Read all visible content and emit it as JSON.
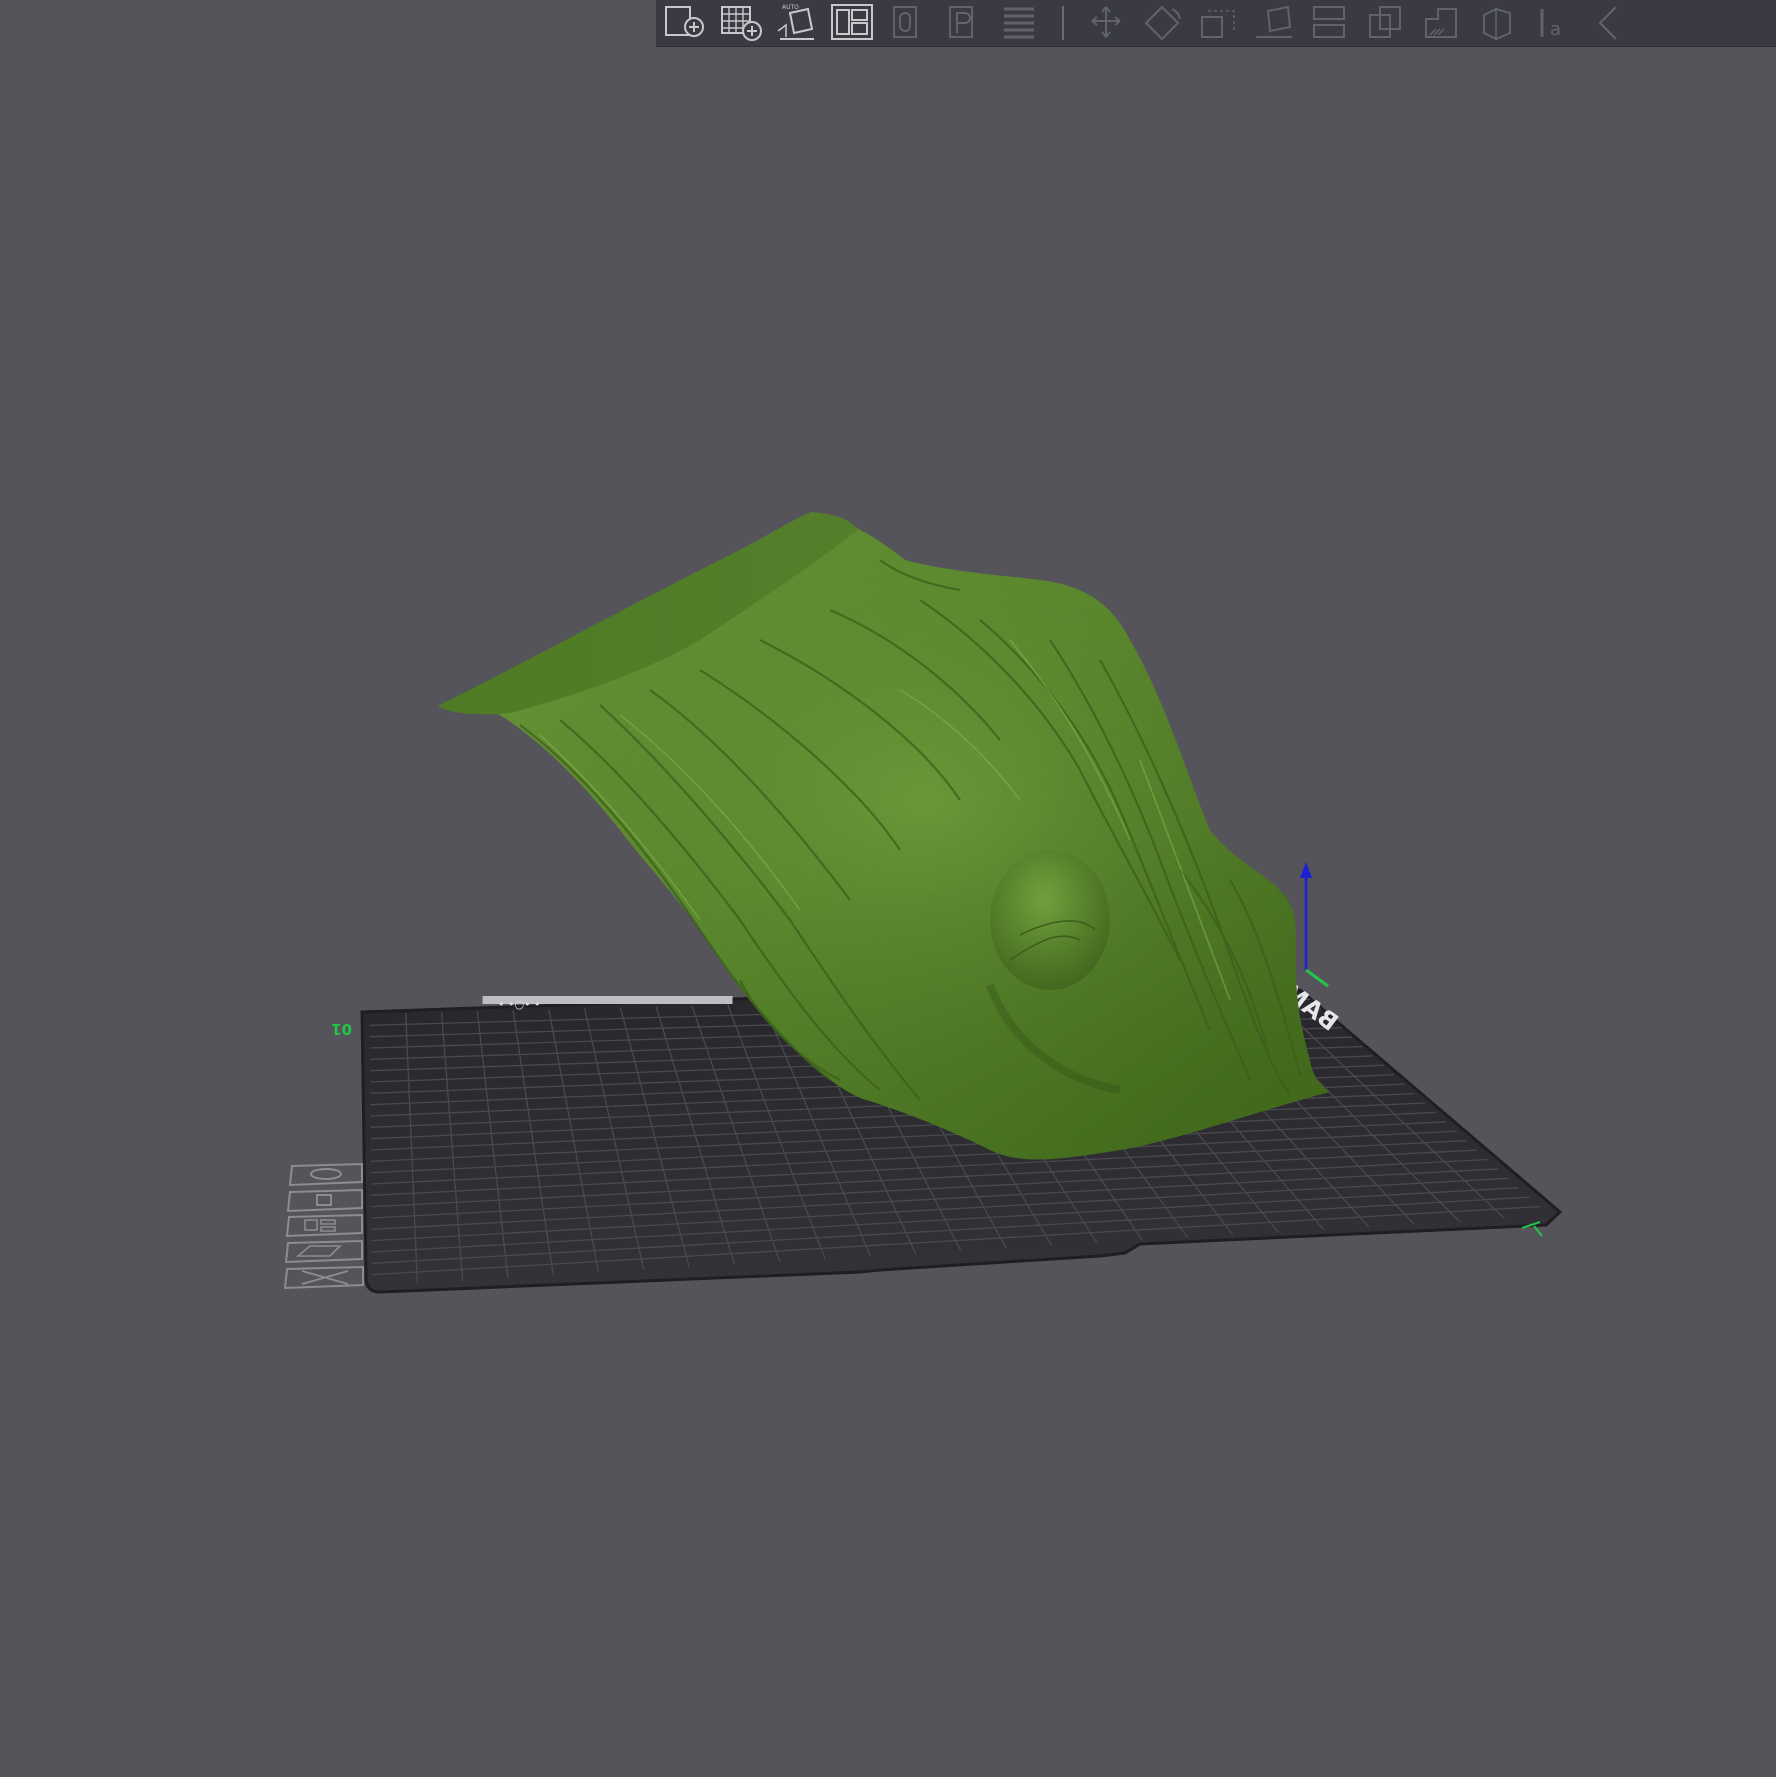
{
  "toolbar": {
    "buttons": [
      {
        "name": "add-object-button",
        "icon": "add-object-icon",
        "enabled": true
      },
      {
        "name": "add-plate-button",
        "icon": "add-plate-icon",
        "enabled": true
      },
      {
        "name": "auto-orient-button",
        "icon": "auto-orient-icon",
        "enabled": true
      },
      {
        "name": "arrange-button",
        "icon": "arrange-icon",
        "enabled": true
      },
      {
        "name": "split-to-objects-button",
        "icon": "split-objects-icon",
        "enabled": false
      },
      {
        "name": "split-to-parts-button",
        "icon": "split-parts-icon",
        "enabled": false
      },
      {
        "name": "layers-button",
        "icon": "layers-icon",
        "enabled": false
      },
      {
        "name": "move-button",
        "icon": "move-icon",
        "enabled": false
      },
      {
        "name": "rotate-button",
        "icon": "rotate-icon",
        "enabled": false
      },
      {
        "name": "scale-button",
        "icon": "scale-icon",
        "enabled": false
      },
      {
        "name": "lay-on-face-button",
        "icon": "lay-on-face-icon",
        "enabled": false
      },
      {
        "name": "cut-button",
        "icon": "cut-icon",
        "enabled": false
      },
      {
        "name": "mesh-boolean-button",
        "icon": "mesh-boolean-icon",
        "enabled": false
      },
      {
        "name": "support-paint-button",
        "icon": "support-paint-icon",
        "enabled": false
      },
      {
        "name": "seam-paint-button",
        "icon": "seam-paint-icon",
        "enabled": false
      },
      {
        "name": "text-button",
        "icon": "text-icon",
        "enabled": false
      },
      {
        "name": "measure-button",
        "icon": "measure-icon",
        "enabled": false
      }
    ],
    "auto_label": "AUTO"
  },
  "plate": {
    "id_label": "01",
    "brand_text": "BAMBU TEXTURED PEI PLATE",
    "colors": {
      "bed": "#2b2a2f",
      "grid": "#4a4950",
      "edge": "#1f1e22"
    }
  },
  "plate_tools": [
    {
      "name": "plate-orient-button",
      "icon": "orient-icon"
    },
    {
      "name": "plate-lock-button",
      "icon": "lock-icon"
    },
    {
      "name": "plate-arrange-button",
      "icon": "arrange-icon"
    },
    {
      "name": "plate-settings-button",
      "icon": "settings-icon"
    },
    {
      "name": "plate-delete-button",
      "icon": "delete-icon"
    }
  ],
  "axes": {
    "x_color": "#22c44a",
    "z_color": "#1b1fd6"
  },
  "model": {
    "name": "tree-stump-model",
    "color": "#5e8c2f"
  }
}
